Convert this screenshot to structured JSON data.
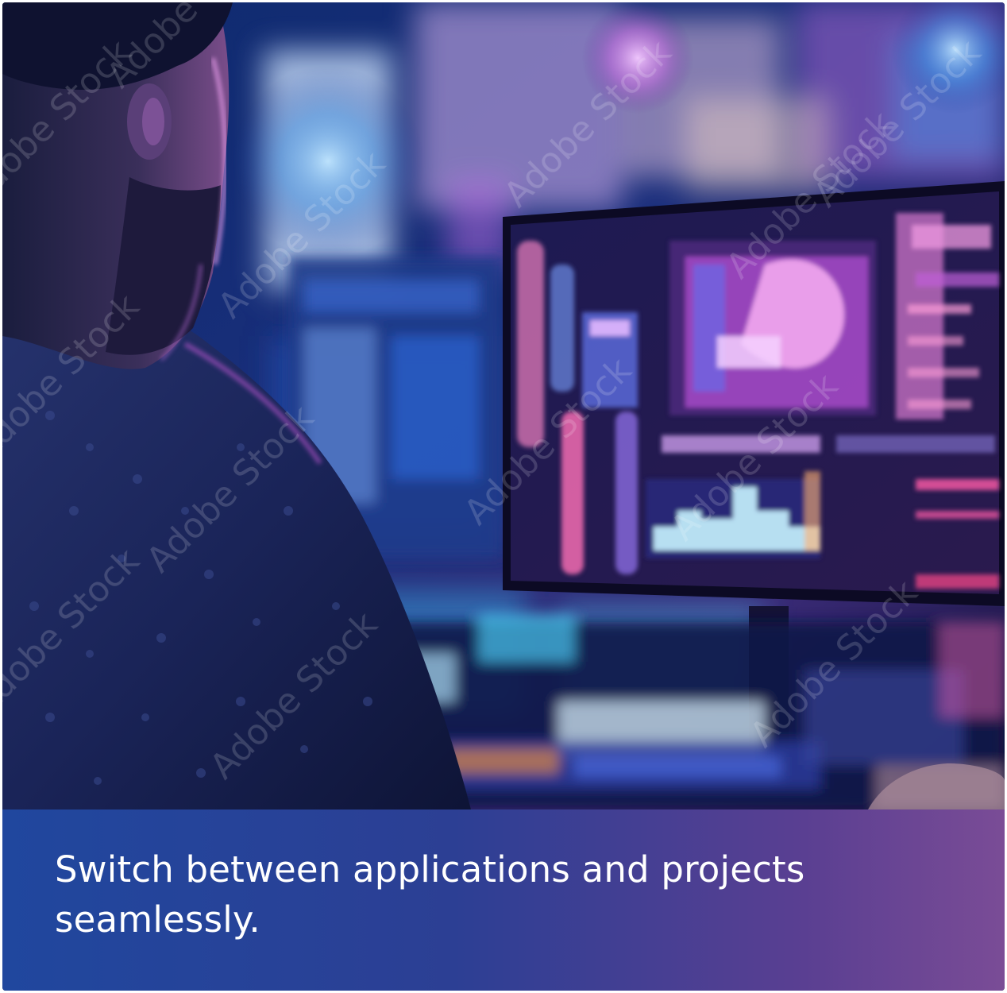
{
  "caption": {
    "text": "Switch between applications and projects seamlessly."
  },
  "photo": {
    "subject": "man-at-computer-monitors",
    "watermark": "Adobe Stock"
  },
  "colors": {
    "panel_start": "#20479e",
    "panel_end": "#7a4c96",
    "caption_text": "#ffffff",
    "scene_blue": "#1a2a6e",
    "scene_magenta": "#c04fc8"
  }
}
